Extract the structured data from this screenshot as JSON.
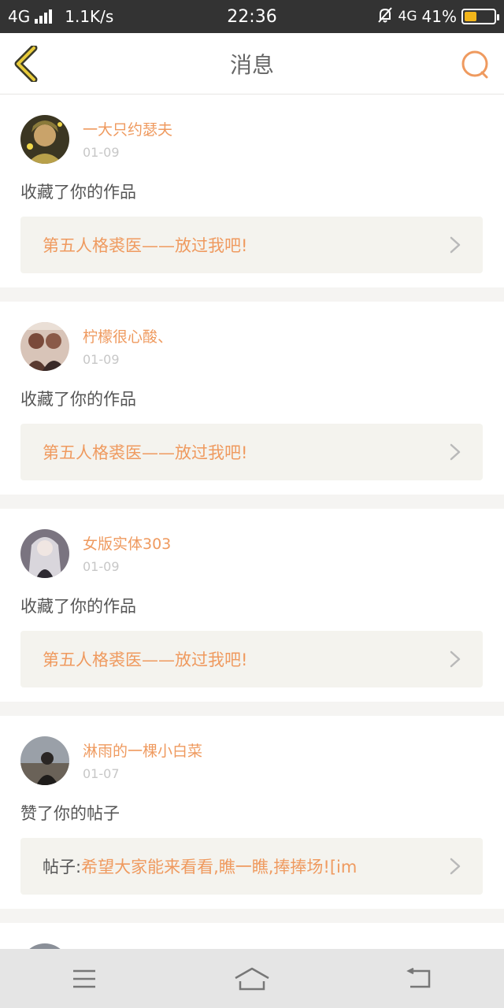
{
  "status_bar": {
    "network": "4G",
    "speed": "1.1K/s",
    "time": "22:36",
    "network_right": "4G",
    "battery_text": "41%",
    "battery_level": 0.41
  },
  "header": {
    "title": "消息"
  },
  "notifications": [
    {
      "username": "一大只约瑟夫",
      "date": "01-09",
      "action": "收藏了你的作品",
      "prefix": "",
      "work": "第五人格裘医——放过我吧!"
    },
    {
      "username": "柠檬很心酸、",
      "date": "01-09",
      "action": "收藏了你的作品",
      "prefix": "",
      "work": "第五人格裘医——放过我吧!"
    },
    {
      "username": "女版实体303",
      "date": "01-09",
      "action": "收藏了你的作品",
      "prefix": "",
      "work": "第五人格裘医——放过我吧!"
    },
    {
      "username": "淋雨的一棵小白菜",
      "date": "01-07",
      "action": "赞了你的帖子",
      "prefix": "帖子:",
      "work": "希望大家能来看看,瞧一瞧,捧捧场![im"
    }
  ],
  "colors": {
    "accent": "#ef9a5f",
    "status_bar": "#333333",
    "battery": "#f2b51a"
  },
  "icons": {
    "back": "chevron-left-icon",
    "search": "search-icon",
    "menu": "menu-icon",
    "home": "home-icon",
    "back_nav": "return-icon"
  }
}
